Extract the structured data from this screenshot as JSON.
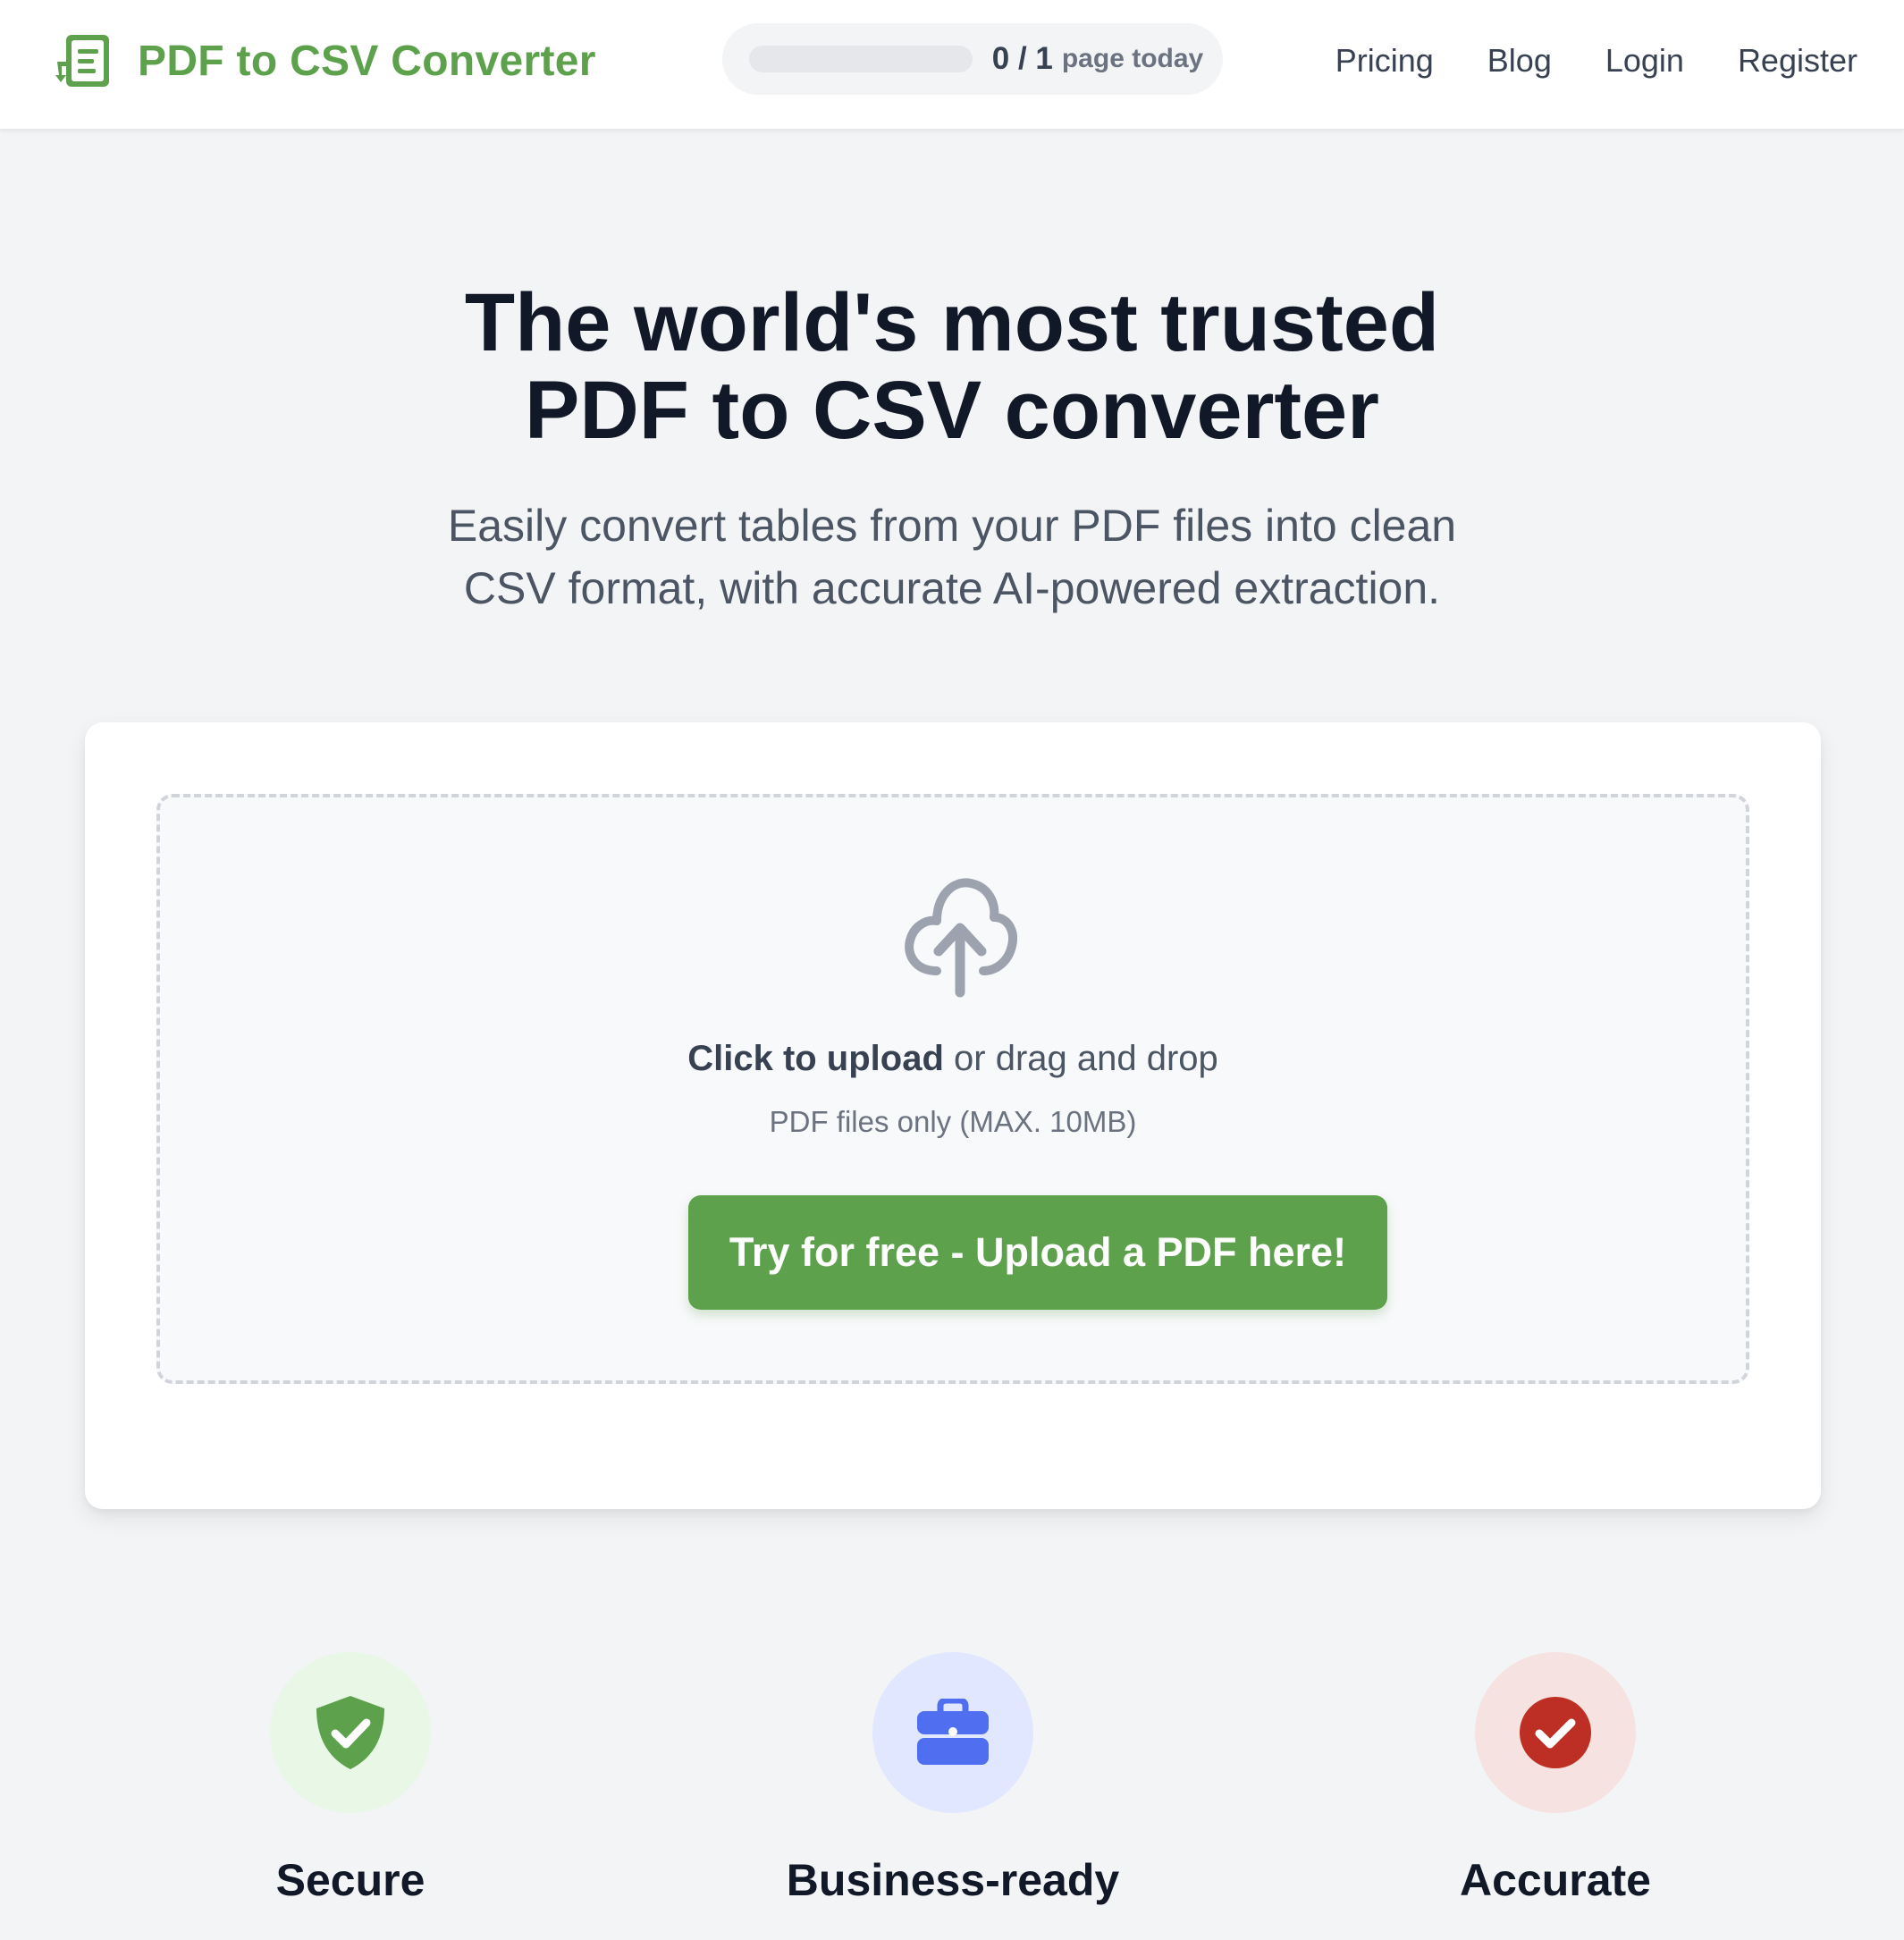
{
  "brand": {
    "name": "PDF to CSV Converter",
    "accent_color": "#5ea14c",
    "logo_icon": "document-list-icon"
  },
  "usage": {
    "count": "0 / 1",
    "label": "page today",
    "progress_fraction": 0
  },
  "nav": {
    "items": [
      {
        "label": "Pricing"
      },
      {
        "label": "Blog"
      },
      {
        "label": "Login"
      },
      {
        "label": "Register"
      }
    ]
  },
  "hero": {
    "title_line1": "The world's most trusted",
    "title_line2": "PDF to CSV converter",
    "subtitle_line1": "Easily convert tables from your PDF files into clean",
    "subtitle_line2": "CSV format, with accurate AI-powered extraction."
  },
  "upload": {
    "icon": "cloud-upload-icon",
    "click_text": "Click to upload",
    "drag_text": " or drag and drop",
    "hint": "PDF files only (MAX. 10MB)",
    "cta_label": "Try for free - Upload a PDF here!"
  },
  "features": [
    {
      "title": "Secure",
      "icon": "shield-check-icon",
      "color": "#5ea14c",
      "bg": "#e8f7e6"
    },
    {
      "title": "Business-ready",
      "icon": "briefcase-icon",
      "color": "#4f6ef0",
      "bg": "#e0e7ff"
    },
    {
      "title": "Accurate",
      "icon": "check-circle-icon",
      "color": "#bd2f24",
      "bg": "#f6e2e0"
    }
  ]
}
